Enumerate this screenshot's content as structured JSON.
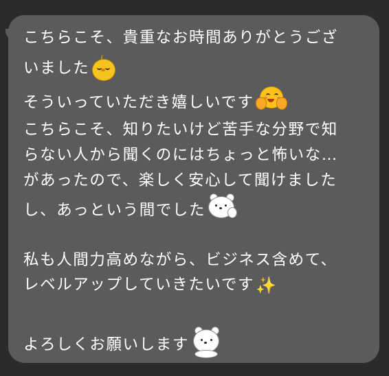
{
  "message": {
    "lines": [
      "こちらこそ、貴重なお時間ありがとうござ",
      "いました",
      "そういっていただき嬉しいです",
      "こちらこそ、知りたいけど苦手な分野で知",
      "らない人から聞くのにはちょっと怖いな…",
      "があったので、楽しく安心して聞けました",
      "し、あっという間でした",
      "私も人間力高めながら、ビジネス含めて、",
      "レベルアップしていきたいです",
      "よろしくお願いします"
    ],
    "sparkles": "✨"
  },
  "icons": {
    "line2_end": "sleepy-chick-icon",
    "line3_end": "hugging-face-icon",
    "line7_end": "white-bear-sticker-icon",
    "line9_end": "sparkles-icon",
    "line10_end": "white-bear-sitting-sticker-icon"
  },
  "colors": {
    "background": "#2b2b2d",
    "bubble": "#5b5b5d",
    "text": "#ffffff"
  }
}
